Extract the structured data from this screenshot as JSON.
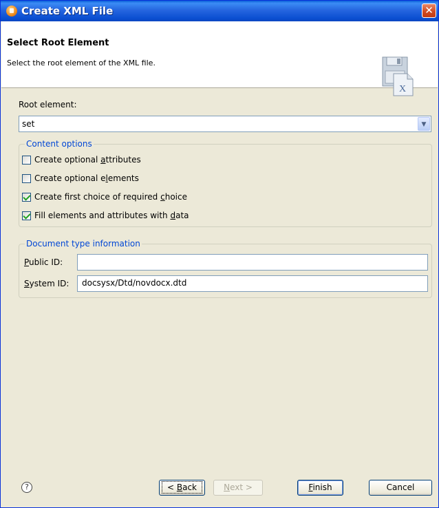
{
  "window": {
    "title": "Create XML File",
    "close_glyph": "✕"
  },
  "header": {
    "title": "Select Root Element",
    "description": "Select the root element of the XML file.",
    "icon": "xml-file-icon"
  },
  "root_element": {
    "label": "Root element:",
    "value": "set",
    "dropdown_glyph": "▼"
  },
  "content_options": {
    "legend": "Content options",
    "items": [
      {
        "pre": "Create optional ",
        "mn": "a",
        "post": "ttributes",
        "checked": false
      },
      {
        "pre": "Create optional e",
        "mn": "l",
        "post": "ements",
        "checked": false
      },
      {
        "pre": "Create first choice of required ",
        "mn": "c",
        "post": "hoice",
        "checked": true
      },
      {
        "pre": "Fill elements and attributes with ",
        "mn": "d",
        "post": "ata",
        "checked": true
      }
    ]
  },
  "doctype": {
    "legend": "Document type information",
    "public_id": {
      "mn": "P",
      "rest": "ublic ID:",
      "value": ""
    },
    "system_id": {
      "mn": "S",
      "rest": "ystem ID:",
      "value": "docsysx/Dtd/novdocx.dtd"
    }
  },
  "footer": {
    "help_glyph": "?",
    "back": {
      "pre": "< ",
      "mn": "B",
      "post": "ack"
    },
    "next": {
      "pre": "",
      "mn": "N",
      "post": "ext >"
    },
    "finish": {
      "pre": "",
      "mn": "F",
      "post": "inish"
    },
    "cancel": "Cancel"
  }
}
